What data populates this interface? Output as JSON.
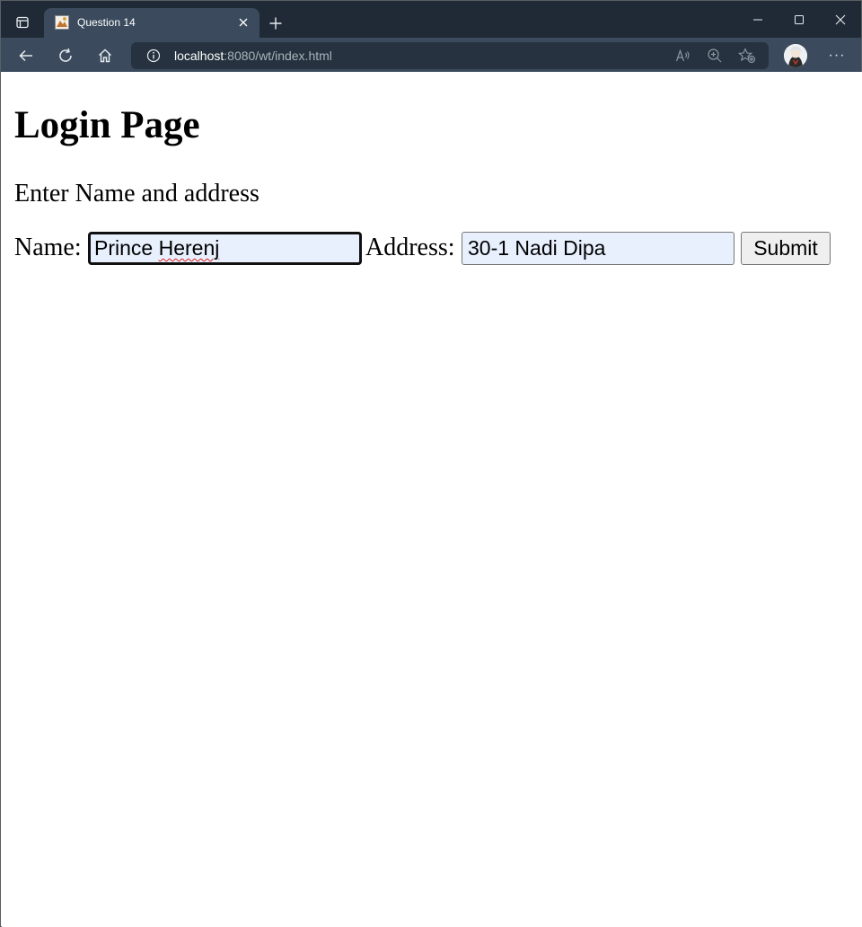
{
  "browser": {
    "tab": {
      "title": "Question 14",
      "favicon": "page-favicon-icon"
    },
    "address": {
      "host": "localhost",
      "rest": ":8080/wt/index.html"
    },
    "menu_label": "···",
    "colors": {
      "tabbar_bg": "#202a36",
      "toolbar_bg": "#3b4b5d",
      "addressbar_bg": "#26323f"
    }
  },
  "page": {
    "title": "Login Page",
    "subtitle": "Enter Name and address",
    "form": {
      "name_label": "Name:",
      "name_value_word": "Prince",
      "name_value_misspelled": "Herenj",
      "address_label": "Address:",
      "address_value": "30-1 Nadi Dipa",
      "submit_label": "Submit",
      "autofill_bg": "#e8f0fe"
    }
  }
}
